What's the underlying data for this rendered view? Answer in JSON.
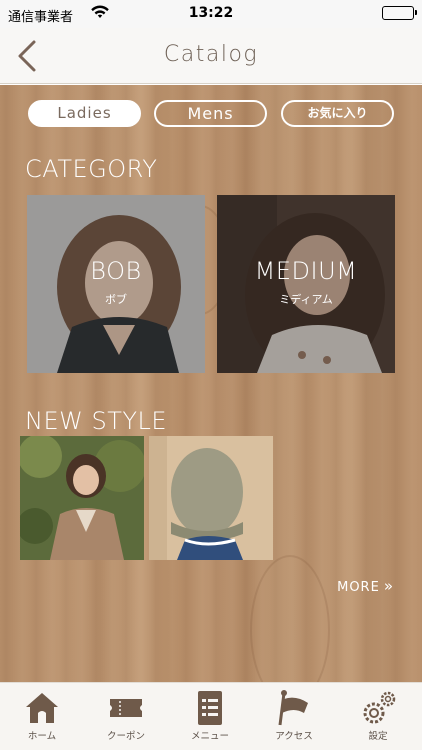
{
  "status_bar": {
    "carrier": "通信事業者",
    "time": "13:22"
  },
  "nav": {
    "title": "Catalog"
  },
  "tabs": [
    {
      "label": "Ladies",
      "selected": true
    },
    {
      "label": "Mens",
      "selected": false
    },
    {
      "label": "お気に入り",
      "selected": false
    }
  ],
  "category": {
    "title": "CATEGORY",
    "items": [
      {
        "label": "BOB",
        "sub": "ボブ"
      },
      {
        "label": "MEDIUM",
        "sub": "ミディアム"
      }
    ]
  },
  "new_style": {
    "title": "NEW STYLE",
    "more": "MORE"
  },
  "tab_bar": {
    "items": [
      {
        "label": "ホーム",
        "icon": "home-icon"
      },
      {
        "label": "クーポン",
        "icon": "coupon-icon"
      },
      {
        "label": "メニュー",
        "icon": "menu-icon"
      },
      {
        "label": "アクセス",
        "icon": "flag-icon"
      },
      {
        "label": "設定",
        "icon": "gear-icon"
      }
    ]
  },
  "colors": {
    "accent": "#6f5a4a",
    "wood": "#b8906c"
  }
}
